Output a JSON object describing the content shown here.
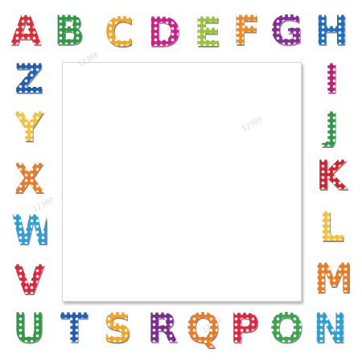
{
  "letters": [
    {
      "char": "A",
      "color": "#e32b36"
    },
    {
      "char": "B",
      "color": "#2f9a45"
    },
    {
      "char": "C",
      "color": "#f5a623"
    },
    {
      "char": "D",
      "color": "#d11e8a"
    },
    {
      "char": "E",
      "color": "#9bc33a"
    },
    {
      "char": "F",
      "color": "#f08a23"
    },
    {
      "char": "G",
      "color": "#8a2a9c"
    },
    {
      "char": "H",
      "color": "#1f6fc1"
    },
    {
      "char": "I",
      "color": "#c01c78"
    },
    {
      "char": "J",
      "color": "#2f9a45"
    },
    {
      "char": "K",
      "color": "#d8212f"
    },
    {
      "char": "L",
      "color": "#f5c23a"
    },
    {
      "char": "M",
      "color": "#f07a22"
    },
    {
      "char": "N",
      "color": "#2aa0d8"
    },
    {
      "char": "O",
      "color": "#3aa64a"
    },
    {
      "char": "P",
      "color": "#e3243a"
    },
    {
      "char": "Q",
      "color": "#f07a22"
    },
    {
      "char": "R",
      "color": "#7b2b92"
    },
    {
      "char": "S",
      "color": "#f5a623"
    },
    {
      "char": "T",
      "color": "#1f5fb5"
    },
    {
      "char": "U",
      "color": "#2f9a45"
    },
    {
      "char": "V",
      "color": "#e3243a"
    },
    {
      "char": "W",
      "color": "#2aa0d8"
    },
    {
      "char": "X",
      "color": "#f07a22"
    },
    {
      "char": "Y",
      "color": "#f5c23a"
    },
    {
      "char": "Z",
      "color": "#1f5fb5"
    }
  ],
  "watermark": "123RF"
}
